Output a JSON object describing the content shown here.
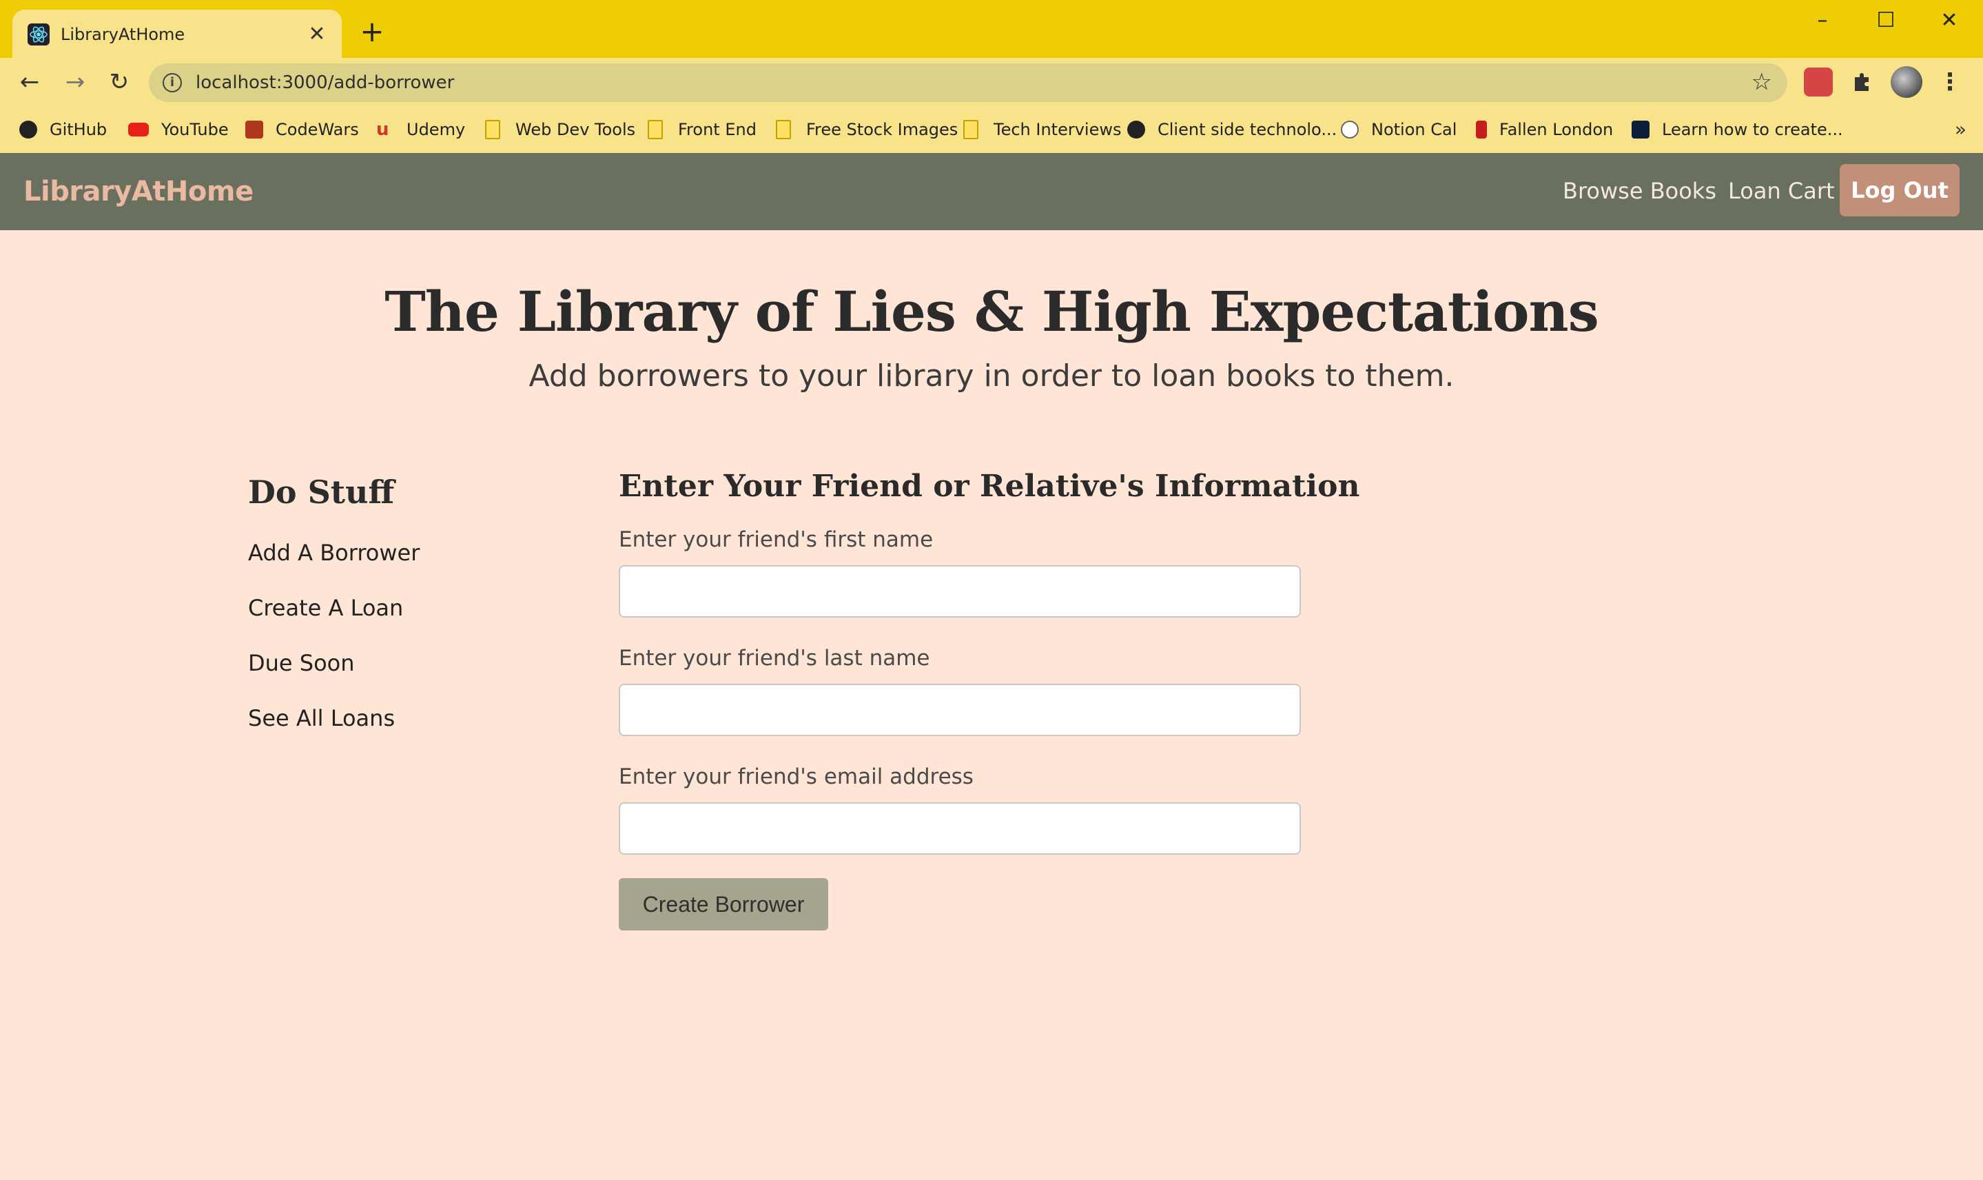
{
  "browser": {
    "tab": {
      "title": "LibraryAtHome",
      "close_glyph": "✕",
      "favicon": "react-icon"
    },
    "new_tab_glyph": "+",
    "window_controls": {
      "minimize": "–",
      "maximize": "☐",
      "close": "✕"
    },
    "nav": {
      "back": "←",
      "forward": "→",
      "reload": "↻"
    },
    "url": "localhost:3000/add-borrower",
    "star_glyph": "☆",
    "menu_glyph": "⋮",
    "bookmarks": [
      {
        "label": "GitHub",
        "icon": "github-icon"
      },
      {
        "label": "YouTube",
        "icon": "youtube-icon"
      },
      {
        "label": "CodeWars",
        "icon": "codewars-icon"
      },
      {
        "label": "Udemy",
        "icon": "udemy-icon"
      },
      {
        "label": "Web Dev Tools",
        "icon": "folder-icon"
      },
      {
        "label": "Front End",
        "icon": "folder-icon"
      },
      {
        "label": "Free Stock Images",
        "icon": "folder-icon"
      },
      {
        "label": "Tech Interviews",
        "icon": "folder-icon"
      },
      {
        "label": "Client side technolo...",
        "icon": "github-icon"
      },
      {
        "label": "Notion Cal",
        "icon": "clock-icon"
      },
      {
        "label": "Fallen London",
        "icon": "fallen-london-icon"
      },
      {
        "label": "Learn how to create...",
        "icon": "site-icon"
      }
    ],
    "bookmarks_more": "»"
  },
  "navbar": {
    "brand": "LibraryAtHome",
    "links": [
      "Browse Books",
      "Loan Cart"
    ],
    "logout": "Log Out"
  },
  "header": {
    "title": "The Library of Lies & High Expectations",
    "subtitle": "Add borrowers to your library in order to loan books to them."
  },
  "sidebar": {
    "title": "Do Stuff",
    "items": [
      "Add A Borrower",
      "Create A Loan",
      "Due Soon",
      "See All Loans"
    ]
  },
  "form": {
    "title": "Enter Your Friend or Relative's Information",
    "fields": [
      {
        "label": "Enter your friend's first name",
        "value": ""
      },
      {
        "label": "Enter your friend's last name",
        "value": ""
      },
      {
        "label": "Enter your friend's email address",
        "value": ""
      }
    ],
    "submit": "Create Borrower"
  },
  "colors": {
    "chrome": "#efcd06",
    "navbar": "#6a705f",
    "page_bg": "#fee5d6",
    "brand": "#eab9a2",
    "logout_bg": "#c28f78",
    "submit_bg": "#a5a48c"
  }
}
